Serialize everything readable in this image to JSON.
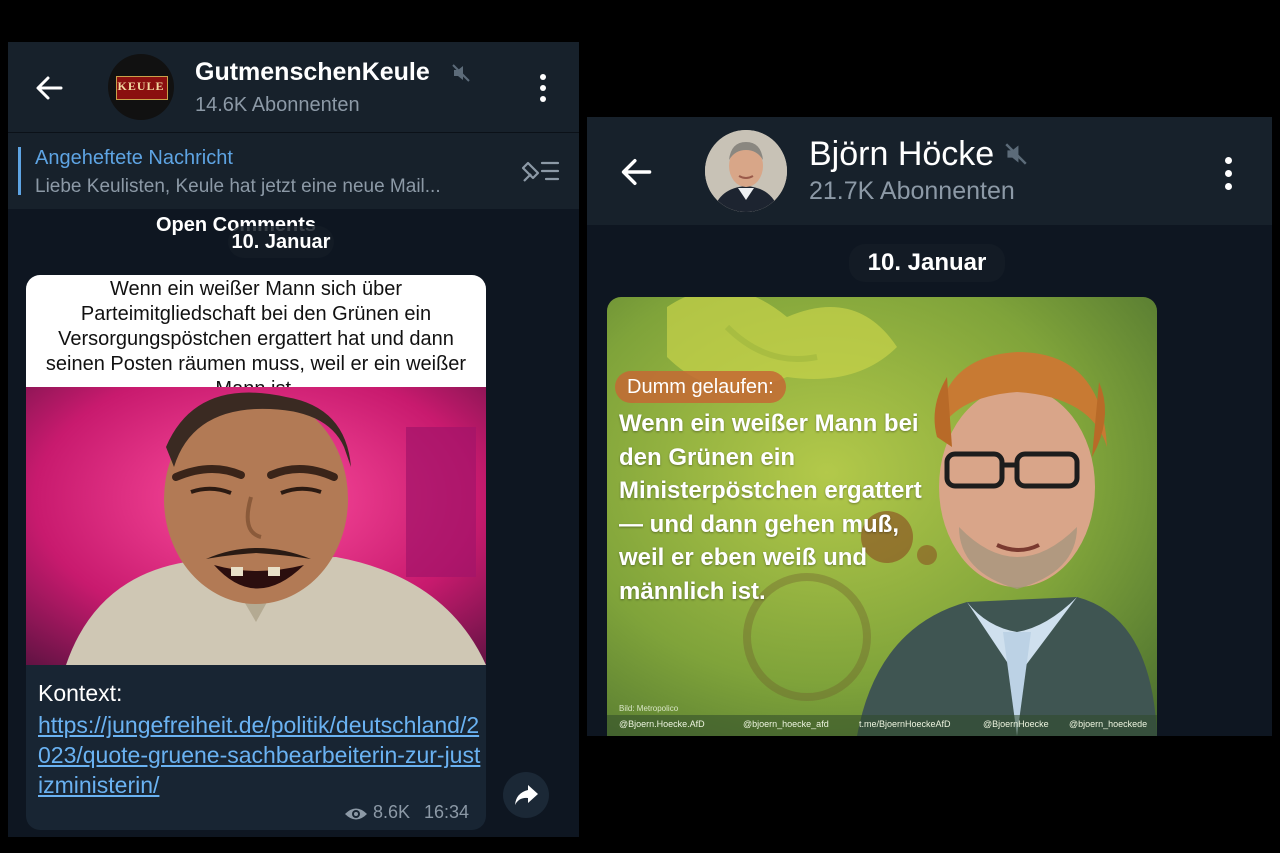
{
  "left": {
    "channel_title": "GutmenschenKeule",
    "subscribers": "14.6K Abonnenten",
    "avatar_logo_text": "KEULE",
    "pinned": {
      "title": "Angeheftete Nachricht",
      "text": "Liebe Keulisten,  Keule hat jetzt eine neue Mail..."
    },
    "open_comments": "Open Comments",
    "date": "10. Januar",
    "post": {
      "meme_caption": "Wenn ein weißer Mann sich über Parteimitgliedschaft bei den Grünen ein Versorgungspöstchen ergattert hat und dann seinen Posten räumen muss, weil er ein weißer Mann ist.",
      "context_label": "Kontext:",
      "link": "https://jungefreiheit.de/politik/deutschland/2023/quote-gruene-sachbearbeiterin-zur-justizministerin/",
      "views": "8.6K",
      "time": "16:34"
    }
  },
  "right": {
    "channel_title": "Björn Höcke",
    "subscribers": "21.7K Abonnenten",
    "date": "10. Januar",
    "post": {
      "tag": "Dumm gelaufen:",
      "quote": "Wenn ein weißer Mann bei den Grünen ein Ministerpöstchen ergattert — und dann gehen muß, weil er eben weiß und männlich ist.",
      "credit": "Bild: Metropolico",
      "footer": [
        "@Bjoern.Hoecke.AfD",
        "@bjoern_hoecke_afd",
        "t.me/BjoernHoeckeAfD",
        "@BjoernHoecke",
        "@bjoern_hoeckede"
      ]
    }
  },
  "colors": {
    "panel_bg": "#0e1621",
    "header_bg": "#17212b",
    "link": "#6ab2f2",
    "accent": "#5ea4e3",
    "muted_text": "#8c99a6"
  }
}
